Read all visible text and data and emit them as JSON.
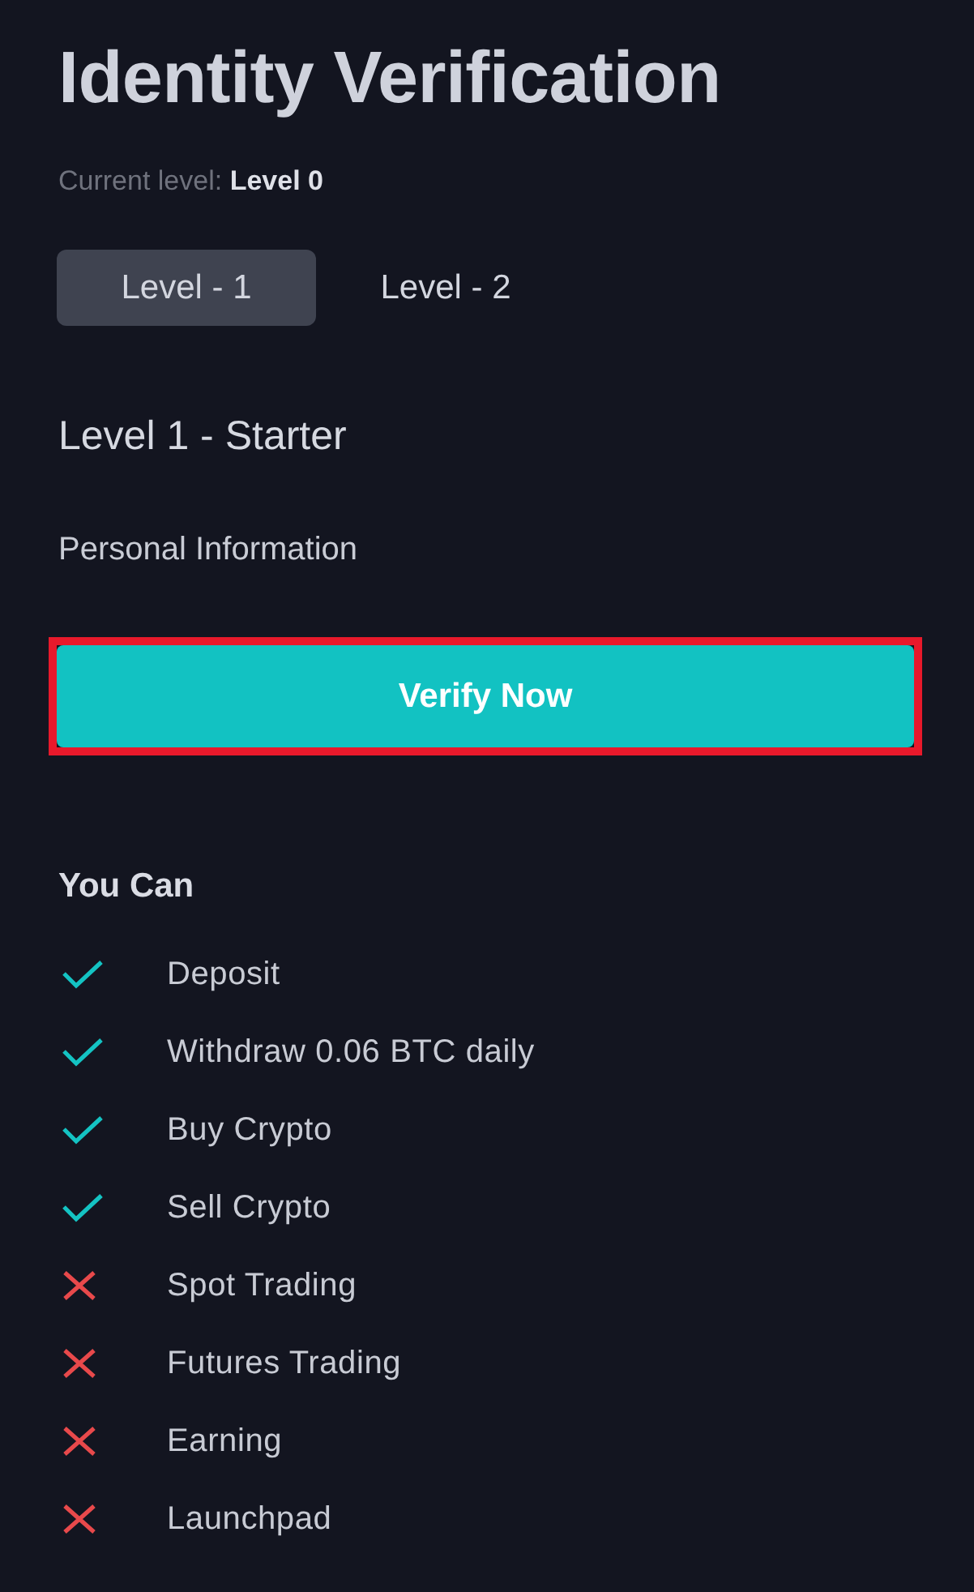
{
  "title": "Identity Verification",
  "current_level": "Current level: **Level 0**",
  "tabs": [
    {
      "label": "Level - 1",
      "selected": true
    },
    {
      "label": "Level - 2",
      "selected": false
    }
  ],
  "level_title": "Level 1 - Starter",
  "requirement": "Personal Information",
  "verify_button": {
    "label": "Verify Now",
    "highlighted": true
  },
  "permissions": {
    "heading": "You Can",
    "items": [
      {
        "label": "Deposit",
        "allowed": true
      },
      {
        "label": "Withdraw 0.06 BTC daily",
        "allowed": true
      },
      {
        "label": "Buy Crypto",
        "allowed": true
      },
      {
        "label": "Sell Crypto",
        "allowed": true
      },
      {
        "label": "Spot Trading",
        "allowed": false
      },
      {
        "label": "Futures Trading",
        "allowed": false
      },
      {
        "label": "Earning",
        "allowed": false
      },
      {
        "label": "Launchpad",
        "allowed": false
      }
    ]
  }
}
